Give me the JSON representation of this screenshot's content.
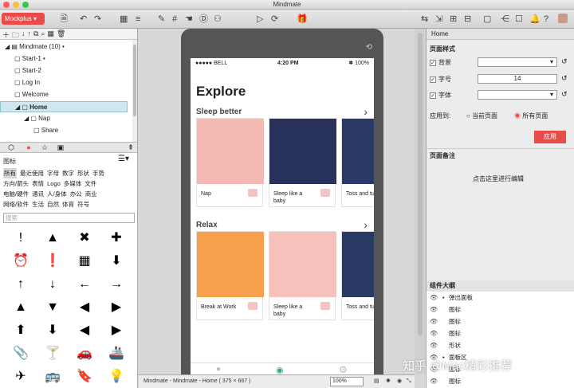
{
  "window": {
    "title": "Mindmate"
  },
  "toolbar": {
    "project_button": "Mockplus ▾"
  },
  "tree": {
    "items": [
      {
        "label": "Mindmate (10)",
        "level": 0,
        "expanded": true,
        "icon": "document-icon",
        "dot": true
      },
      {
        "label": "Start-1",
        "level": 1,
        "dot": true
      },
      {
        "label": "Start-2",
        "level": 1
      },
      {
        "label": "Log In",
        "level": 1
      },
      {
        "label": "Welcome",
        "level": 1
      },
      {
        "label": "Home",
        "level": 1,
        "selected": true,
        "expanded": true
      },
      {
        "label": "Nap",
        "level": 2,
        "expanded": true
      },
      {
        "label": "Share",
        "level": 3
      }
    ]
  },
  "library": {
    "title": "图标",
    "categories": [
      [
        "所有",
        "最近使用",
        "字母",
        "数字",
        "形状",
        "手势"
      ],
      [
        "方向/箭头",
        "表情",
        "Logo",
        "多媒体",
        "文件"
      ],
      [
        "电脑/硬件",
        "通讯",
        "人/身体",
        "办公",
        "商业"
      ],
      [
        "网络/软件",
        "生活",
        "自然",
        "体育",
        "符号"
      ]
    ],
    "selected_category": "所有",
    "search_placeholder": "搜索",
    "icons": [
      "!",
      "▲",
      "✖",
      "✚",
      "⏰",
      "❗",
      "▦",
      "⬇",
      "↑",
      "↓",
      "←",
      "→",
      "▲",
      "▼",
      "◀",
      "▶",
      "⬆",
      "⬇",
      "◀",
      "▶",
      "📎",
      "🍸",
      "🚗",
      "🚢",
      "✈",
      "🚌",
      "🔖",
      "💡"
    ]
  },
  "phone": {
    "status": {
      "carrier": "●●●●● BELL",
      "time": "4:20 PM",
      "battery": "✱ 100%"
    },
    "title": "Explore",
    "sections": [
      {
        "title": "Sleep better",
        "cards": [
          {
            "label": "Nap",
            "bg": "#f4b9b2"
          },
          {
            "label": "Sleep like a baby",
            "bg": "#273159"
          },
          {
            "label": "Toss and tu",
            "bg": "#2a3a66"
          }
        ]
      },
      {
        "title": "Relax",
        "cards": [
          {
            "label": "Break at Work",
            "bg": "#f6a04d"
          },
          {
            "label": "Sleep like a baby",
            "bg": "#f7c1bb"
          },
          {
            "label": "Toss and tu",
            "bg": "#2a3a66"
          }
        ]
      }
    ]
  },
  "statusbar": {
    "path": "Mindmate - Mindmate - Home ( 375 × 667 )",
    "zoom": "100%"
  },
  "inspector": {
    "header": "Home",
    "page_style": "页面样式",
    "bg_label": "背景",
    "fontsize_label": "字号",
    "fontsize_value": "14",
    "font_label": "字体",
    "apply_to": "应用到:",
    "current_page": "当前页面",
    "all_pages": "所有页面",
    "apply_button": "应用",
    "notes_title": "页面备注",
    "notes_placeholder": "点击这里进行编辑",
    "outline_title": "组件大纲",
    "outline": [
      {
        "label": "弹出面板",
        "bullet": true
      },
      {
        "label": "图标"
      },
      {
        "label": "图标"
      },
      {
        "label": "图标"
      },
      {
        "label": "形状"
      },
      {
        "label": "面板区",
        "bullet": true
      },
      {
        "label": "图标"
      },
      {
        "label": "图标"
      }
    ]
  },
  "watermark": "知乎 @Mac精彩推荐",
  "colors": {
    "accent": "#e94b49",
    "selection": "#cfe8f0"
  }
}
